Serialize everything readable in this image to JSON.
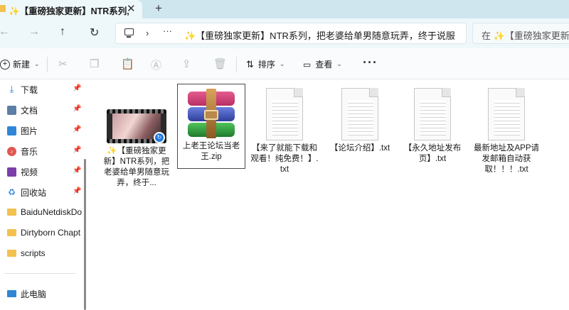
{
  "colors": {
    "titlebar_bg": "#cfe6ee",
    "navbar_bg": "#eef7fa",
    "folder_yellow": "#f2c14e",
    "selection_border": "#4a4a4a",
    "accent_blue": "#1f7ae0"
  },
  "tab": {
    "title": "✨【重磅独家更新】NTR系列,",
    "close_icon": "✕",
    "new_tab_icon": "+"
  },
  "nav": {
    "back_icon": "←",
    "forward_icon": "→",
    "up_icon": "↑",
    "refresh_icon": "↻",
    "chevron": "›",
    "dots": "···",
    "path": "✨【重磅独家更新】NTR系列，把老婆给单男随意玩弄，终于说服老",
    "search_placeholder": "在 ✨【重磅独家更新"
  },
  "toolbar": {
    "new_label": "新建",
    "sort_label": "排序",
    "view_label": "查看",
    "more_label": "···",
    "icons": [
      "cut-icon",
      "copy-icon",
      "paste-icon",
      "rename-icon",
      "share-icon",
      "delete-icon"
    ]
  },
  "sidebar": {
    "items": [
      {
        "label": "下载",
        "icon": "download-icon",
        "pinned": true
      },
      {
        "label": "文档",
        "icon": "document-icon",
        "pinned": true
      },
      {
        "label": "图片",
        "icon": "pictures-icon",
        "pinned": true
      },
      {
        "label": "音乐",
        "icon": "music-icon",
        "pinned": true
      },
      {
        "label": "视频",
        "icon": "video-icon",
        "pinned": true
      },
      {
        "label": "回收站",
        "icon": "recycle-bin-icon",
        "pinned": true
      },
      {
        "label": "BaiduNetdiskDo",
        "icon": "folder-icon",
        "pinned": false
      },
      {
        "label": "Dirtyborn Chapt",
        "icon": "folder-icon",
        "pinned": false
      },
      {
        "label": "scripts",
        "icon": "folder-icon",
        "pinned": false
      },
      {
        "label": "此电脑",
        "icon": "this-pc-icon",
        "pinned": false
      }
    ],
    "pin_icon": "📌"
  },
  "files": [
    {
      "name": "✨【重磅独家更新】NTR系列，把老婆给单男随意玩弄，终于...",
      "type": "video"
    },
    {
      "name": "上老王论坛当老王.zip",
      "type": "zip",
      "selected": true
    },
    {
      "name": "【来了就能下载和观看！纯免费！】.txt",
      "type": "txt"
    },
    {
      "name": "【论坛介绍】.txt",
      "type": "txt"
    },
    {
      "name": "【永久地址发布页】.txt",
      "type": "txt"
    },
    {
      "name": "最新地址及APP请发邮箱自动获取！！！.txt",
      "type": "txt"
    }
  ]
}
